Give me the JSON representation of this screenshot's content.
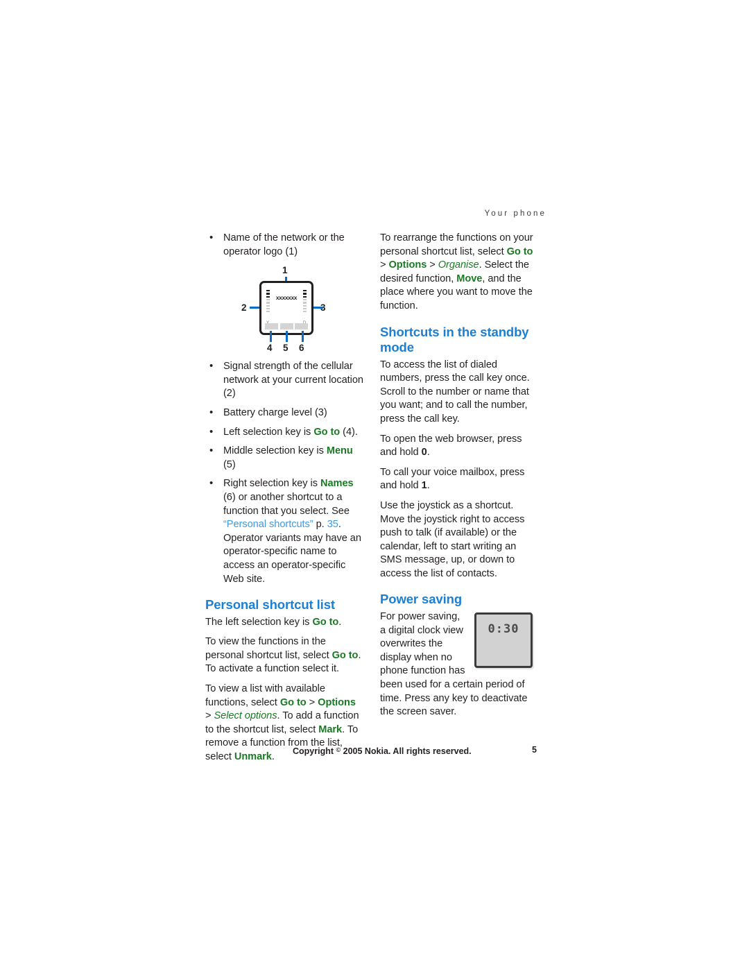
{
  "header": {
    "running_head": "Your phone"
  },
  "colors": {
    "heading_blue": "#1b7fd3",
    "ui_green": "#1a7a24",
    "xref_blue": "#3c9ae0",
    "body_black": "#231f20",
    "leader_blue": "#0a6cc4"
  },
  "left_column": {
    "bullet_1": {
      "text": "Name of the network or the operator logo (1)"
    },
    "figure": {
      "name": "standby-display-diagram",
      "network_name_sample": "xxxxxxx",
      "callouts": [
        "1",
        "2",
        "3",
        "4",
        "5",
        "6"
      ],
      "signal_glyph": "Y",
      "battery_glyph": "D"
    },
    "bullets": [
      {
        "text": "Signal strength of the cellular network at your current location (2)"
      },
      {
        "text": "Battery charge level (3)"
      },
      {
        "pre": "Left selection key is ",
        "ui": "Go to",
        "post": " (4)."
      },
      {
        "pre": "Middle selection key is ",
        "ui": "Menu",
        "post": " (5)"
      },
      {
        "pre": "Right selection key is ",
        "ui": "Names",
        "post": " (6) or another shortcut to a function that you select. See ",
        "xref": "“Personal shortcuts”",
        "post2": " p. ",
        "xref2": "35",
        "post3": ". Operator variants may have an operator-specific name to access an operator-specific Web site."
      }
    ],
    "section": {
      "heading": "Personal shortcut list",
      "p1_pre": "The left selection key is ",
      "p1_ui": "Go to",
      "p1_post": ".",
      "p2_a": "To view the functions in the personal shortcut list, select ",
      "p2_ui1": "Go to",
      "p2_b": ". To activate a function select it.",
      "p3_a": "To view a list with available functions, select ",
      "p3_ui1": "Go to",
      "p3_sep1": " > ",
      "p3_ui2": "Options",
      "p3_sep2": " > ",
      "p3_it": "Select options",
      "p3_b": ". To add a function to the shortcut list, select ",
      "p3_ui3": "Mark",
      "p3_c": ". To remove a function from the list, select ",
      "p3_ui4": "Unmark",
      "p3_d": "."
    }
  },
  "right_column": {
    "intro": {
      "a": "To rearrange the functions on your personal shortcut list, select ",
      "ui1": "Go to",
      "sep1": " > ",
      "ui2": "Options",
      "sep2": " > ",
      "it1": "Organise",
      "b": ". Select the desired function, ",
      "ui3": "Move",
      "c": ", and the place where you want to move the function."
    },
    "shortcuts": {
      "heading": "Shortcuts in the standby mode",
      "p1": "To access the list of dialed numbers, press the call key once. Scroll to the number or name that you want; and to call the number, press the call key.",
      "p2_a": "To open the web browser, press and hold ",
      "p2_key": "0",
      "p2_b": ".",
      "p3_a": "To call your voice mailbox, press and hold ",
      "p3_key": "1",
      "p3_b": ".",
      "p4": "Use the joystick as a shortcut. Move the joystick right to access push to talk (if available) or the calendar, left to start writing an SMS message, up, or down to access the list of contacts."
    },
    "power_saving": {
      "heading": "Power saving",
      "figure": {
        "name": "digital-clock-screensaver",
        "digits": "0:30"
      },
      "p1": "For power saving, a digital clock view overwrites the display when no phone function has been used for a certain period of time. Press any key to deactivate the screen saver."
    }
  },
  "footer": {
    "copyright_pre": "Copyright ",
    "copyright_symbol": "©",
    "copyright_post": " 2005 Nokia. All rights reserved.",
    "page_number": "5"
  }
}
